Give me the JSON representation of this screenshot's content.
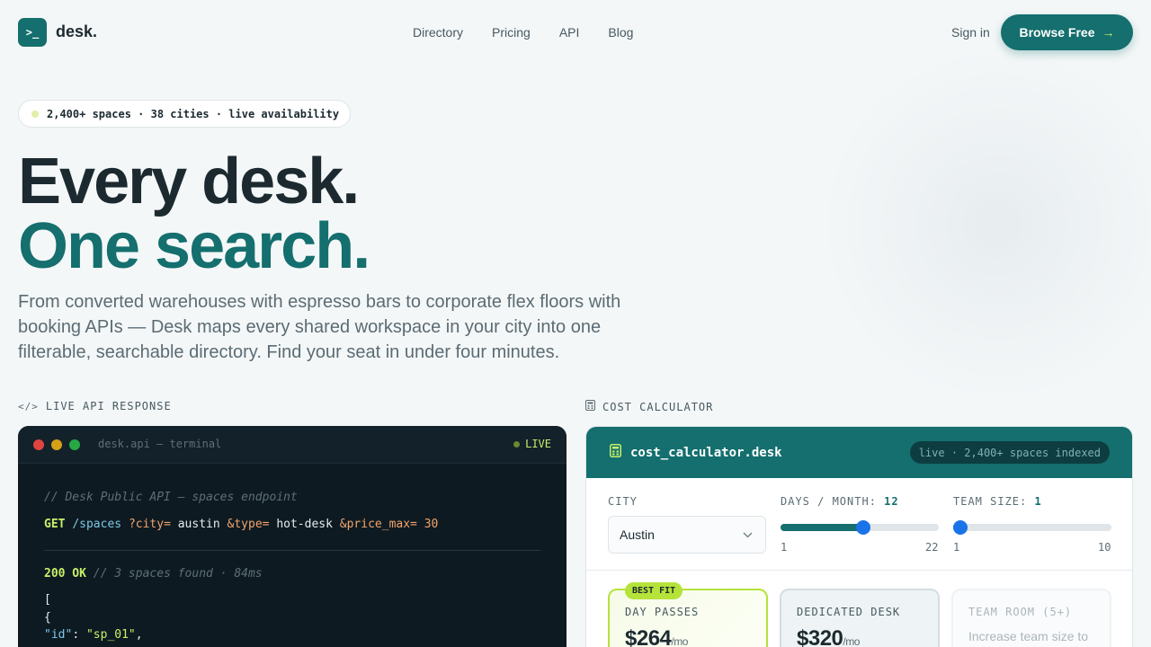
{
  "brand": {
    "logo_glyph": ">_",
    "name": "desk."
  },
  "nav": {
    "links": [
      "Directory",
      "Pricing",
      "API",
      "Blog"
    ],
    "signin": "Sign in",
    "cta": "Browse Free",
    "cta_arrow": "→"
  },
  "badge": {
    "text": "2,400+ spaces · 38 cities · live availability"
  },
  "hero": {
    "line1": "Every desk.",
    "line2": "One search.",
    "lead": "From converted warehouses with espresso bars to corporate flex floors with booking APIs — Desk maps every shared workspace in your city into one filterable, searchable directory. Find your seat in under four minutes."
  },
  "api_section": {
    "label": "LIVE API RESPONSE",
    "terminal_title": "desk.api — terminal",
    "live": "LIVE",
    "comment": "// Desk Public API — spaces endpoint",
    "method": "GET",
    "path": "/spaces",
    "params": [
      {
        "key": "?city=",
        "value": "austin"
      },
      {
        "key": "&type=",
        "value": "hot-desk"
      },
      {
        "key": "&price_max=",
        "value": "30"
      }
    ],
    "status": "200 OK",
    "status_comment": "// 3 spaces found · 84ms",
    "json_open_bracket": "[",
    "json_open_brace": "{",
    "json_id_key": "\"id\"",
    "json_id_value": "\"sp_01\""
  },
  "calc_section": {
    "label": "COST CALCULATOR",
    "title": "cost_calculator.desk",
    "pill": "live · 2,400+ spaces indexed",
    "city_label": "CITY",
    "city_value": "Austin",
    "days_label": "DAYS / MONTH:",
    "days_value": "12",
    "days_min": "1",
    "days_max": "22",
    "team_label": "TEAM SIZE:",
    "team_value": "1",
    "team_min": "1",
    "team_max": "10",
    "days_fraction": 0.524,
    "team_fraction": 0.0,
    "plans": [
      {
        "name": "DAY PASSES",
        "price": "$264",
        "unit": "/mo",
        "badge": "BEST FIT"
      },
      {
        "name": "DEDICATED DESK",
        "price": "$320",
        "unit": "/mo"
      },
      {
        "name": "TEAM ROOM (5+)",
        "note": "Increase team size to"
      }
    ]
  },
  "colors": {
    "primary": "#146f6e",
    "accent": "#c6f06a",
    "terminal_bg": "#0e1a21",
    "knob": "#1a73e8"
  }
}
